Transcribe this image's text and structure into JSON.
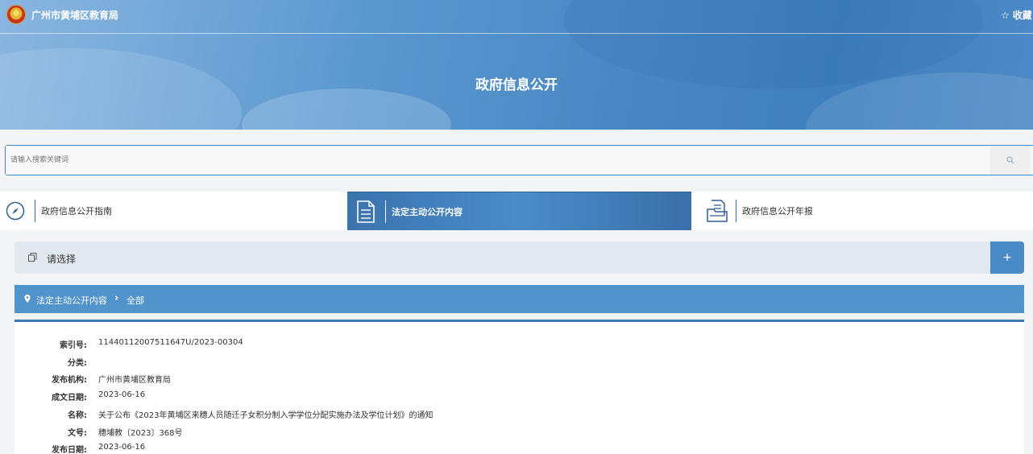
{
  "header": {
    "site_title": "广州市黄埔区教育局",
    "favorite_label": "☆ 收藏",
    "page_title": "政府信息公开"
  },
  "search": {
    "placeholder": "请输入搜索关键词"
  },
  "tabs": [
    {
      "label": "政府信息公开指南",
      "icon": "compass-icon",
      "active": false
    },
    {
      "label": "法定主动公开内容",
      "icon": "document-icon",
      "active": true
    },
    {
      "label": "政府信息公开年报",
      "icon": "folder-document-icon",
      "active": false
    }
  ],
  "select_bar": {
    "label": "请选择",
    "expand_label": "+"
  },
  "breadcrumb": {
    "section": "法定主动公开内容",
    "separator": "›",
    "current": "全部"
  },
  "details": [
    {
      "key": "索引号:",
      "value": "11440112007511647U/2023-00304"
    },
    {
      "key": "分类:",
      "value": ""
    },
    {
      "key": "发布机构:",
      "value": "广州市黄埔区教育局"
    },
    {
      "key": "成文日期:",
      "value": "2023-06-16"
    },
    {
      "key": "名称:",
      "value": "关于公布《2023年黄埔区来穗人员随迁子女积分制入学学位分配实施办法及学位计划》的通知"
    },
    {
      "key": "文号:",
      "value": "穗埔教〔2023〕368号"
    },
    {
      "key": "发布日期:",
      "value": "2023-06-16"
    }
  ],
  "colors": {
    "accent": "#4a8ac6",
    "active_tab": "#3b73ad",
    "breadcrumb_bg": "#5193cb"
  }
}
